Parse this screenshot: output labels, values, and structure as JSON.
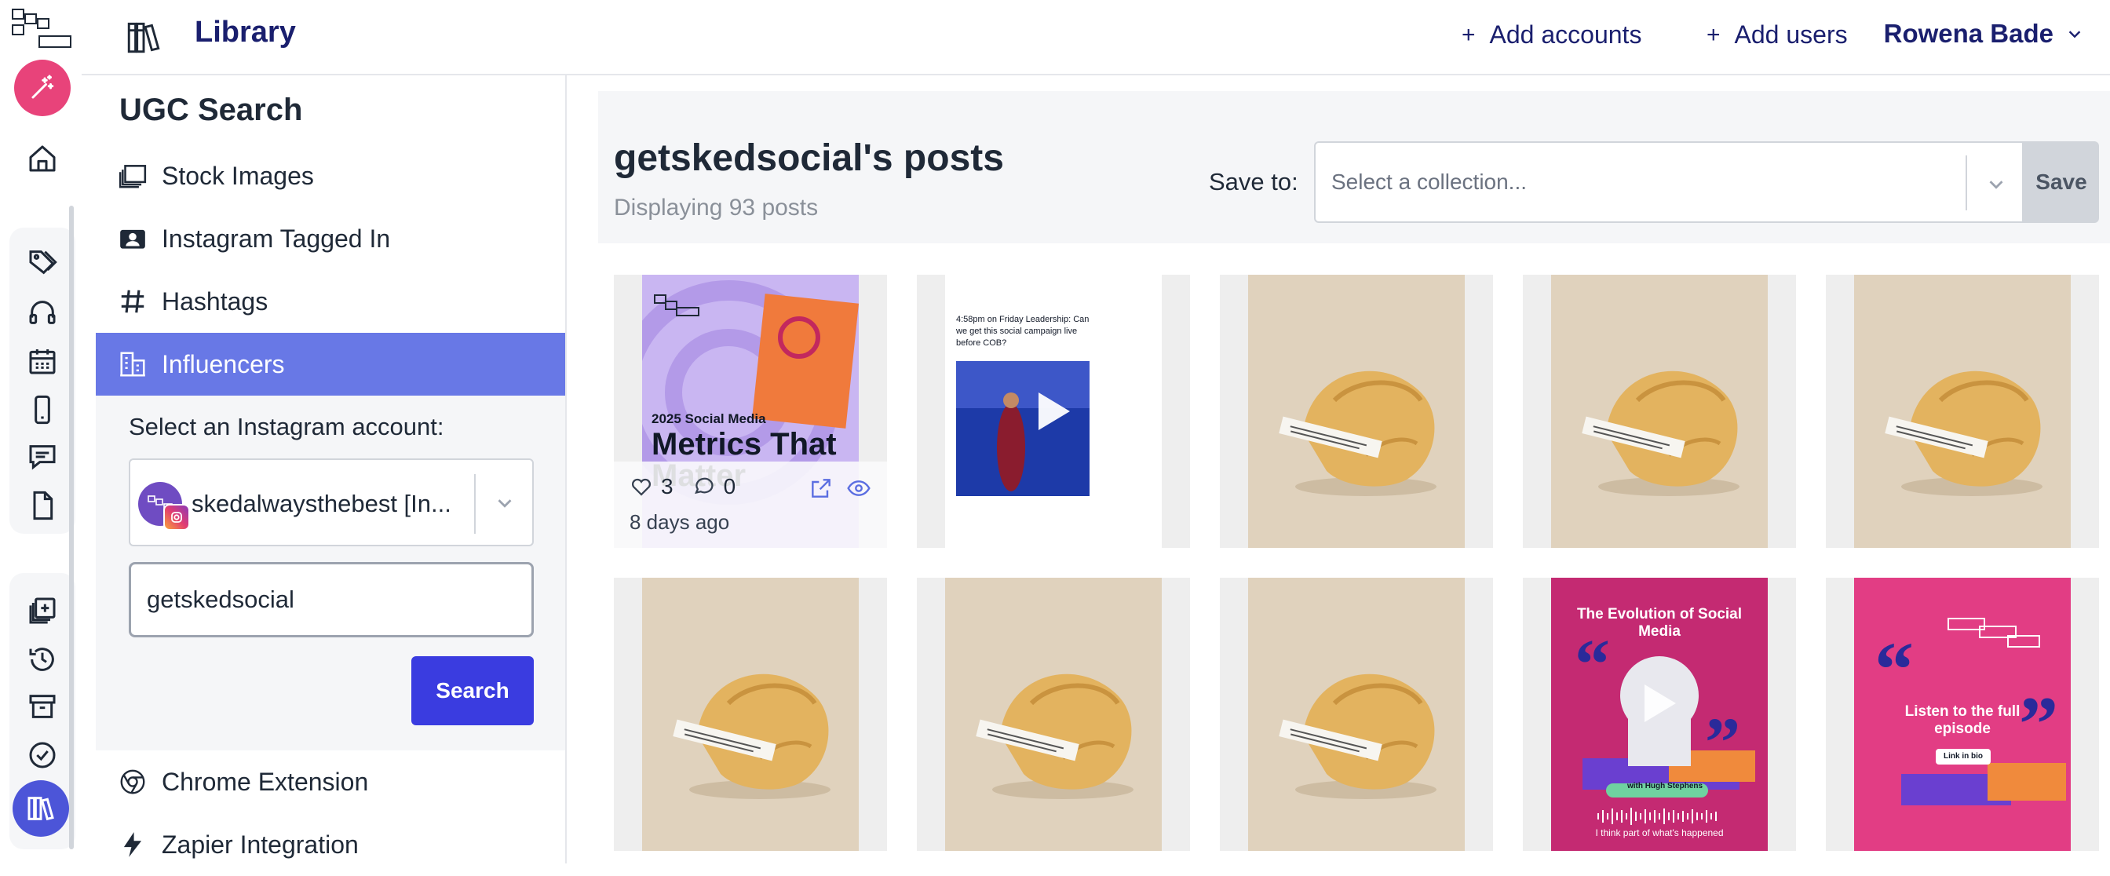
{
  "colors": {
    "brand_navy": "#1a1f6e",
    "accent_pink": "#e8437a",
    "accent_blue": "#3a3ce0",
    "nav_active": "#6878e6"
  },
  "rail": {
    "icons": [
      "sked-social-logo",
      "magic-wand-icon",
      "home-icon",
      "tag-icon",
      "headphones-icon",
      "calendar-icon",
      "mobile-icon",
      "chat-icon",
      "document-icon",
      "add-library-icon",
      "history-icon",
      "archive-icon",
      "check-circle-icon",
      "library-icon"
    ]
  },
  "header": {
    "title": "Library",
    "add_accounts": "Add accounts",
    "add_users": "Add users",
    "plus": "+",
    "user_name": "Rowena Bade"
  },
  "sidebar": {
    "heading": "UGC Search",
    "items": [
      {
        "label": "Stock Images",
        "icon": "stock-images-icon"
      },
      {
        "label": "Instagram Tagged In",
        "icon": "person-tag-icon"
      },
      {
        "label": "Hashtags",
        "icon": "hashtag-icon"
      },
      {
        "label": "Influencers",
        "icon": "building-icon",
        "active": true
      },
      {
        "label": "Chrome Extension",
        "icon": "chrome-icon"
      },
      {
        "label": "Zapier Integration",
        "icon": "bolt-icon"
      }
    ],
    "panel": {
      "account_label": "Select an Instagram account:",
      "account_value": "skedalwaysthebest [In...",
      "handle_value": "getskedsocial",
      "search_label": "Search"
    }
  },
  "main": {
    "posts_title": "getskedsocial's posts",
    "posts_count": "Displaying 93 posts",
    "save_to_label": "Save to:",
    "collection_placeholder": "Select a collection...",
    "save_label": "Save",
    "first_post": {
      "likes": "3",
      "comments": "0",
      "age": "8 days ago"
    },
    "posts": [
      {
        "kind": "metrics",
        "headline_small": "2025 Social Media",
        "headline_big": "Metrics That Matter"
      },
      {
        "kind": "video-tweet",
        "caption": "4:58pm on Friday Leadership: Can we get this social campaign live before COB?"
      },
      {
        "kind": "fortune"
      },
      {
        "kind": "fortune"
      },
      {
        "kind": "fortune"
      },
      {
        "kind": "fortune"
      },
      {
        "kind": "fortune"
      },
      {
        "kind": "fortune"
      },
      {
        "kind": "podcast",
        "title": "The Evolution of Social Media",
        "guest": "with Hugh Stephens",
        "quote": "I think part of what's happened"
      },
      {
        "kind": "podcast-full",
        "title": "Listen to the full episode",
        "cta": "Link in bio"
      }
    ]
  }
}
